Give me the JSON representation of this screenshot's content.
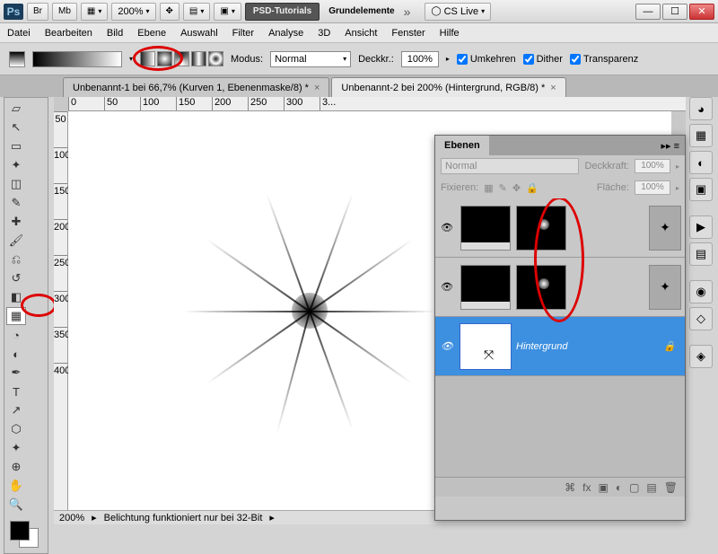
{
  "titlebar": {
    "logo": "Ps",
    "br": "Br",
    "mb": "Mb",
    "zoom": "200%",
    "workspace": "PSD-Tutorials",
    "workspace2": "Grundelemente",
    "cslive": "CS Live"
  },
  "menu": [
    "Datei",
    "Bearbeiten",
    "Bild",
    "Ebene",
    "Auswahl",
    "Filter",
    "Analyse",
    "3D",
    "Ansicht",
    "Fenster",
    "Hilfe"
  ],
  "options": {
    "modus_label": "Modus:",
    "modus_value": "Normal",
    "deckk_label": "Deckkr.:",
    "deckk_value": "100%",
    "cb_umkehren": "Umkehren",
    "cb_dither": "Dither",
    "cb_transparenz": "Transparenz"
  },
  "tabs": [
    {
      "label": "Unbenannt-1 bei 66,7% (Kurven 1, Ebenenmaske/8) *"
    },
    {
      "label": "Unbenannt-2 bei 200% (Hintergrund, RGB/8) *"
    }
  ],
  "ruler_h": [
    "0",
    "50",
    "100",
    "150",
    "200",
    "250",
    "300",
    "3..."
  ],
  "ruler_v": [
    "50",
    "100",
    "150",
    "200",
    "250",
    "300",
    "350",
    "400"
  ],
  "status": {
    "zoom": "200%",
    "msg": "Belichtung funktioniert nur bei 32-Bit"
  },
  "layers_panel": {
    "title": "Ebenen",
    "blend": "Normal",
    "opacity_label": "Deckkraft:",
    "opacity_value": "100%",
    "lock_label": "Fixieren:",
    "fill_label": "Fläche:",
    "fill_value": "100%",
    "layers": [
      {
        "name": "",
        "type": "adjust"
      },
      {
        "name": "",
        "type": "adjust"
      },
      {
        "name": "Hintergrund",
        "type": "bg"
      }
    ]
  }
}
